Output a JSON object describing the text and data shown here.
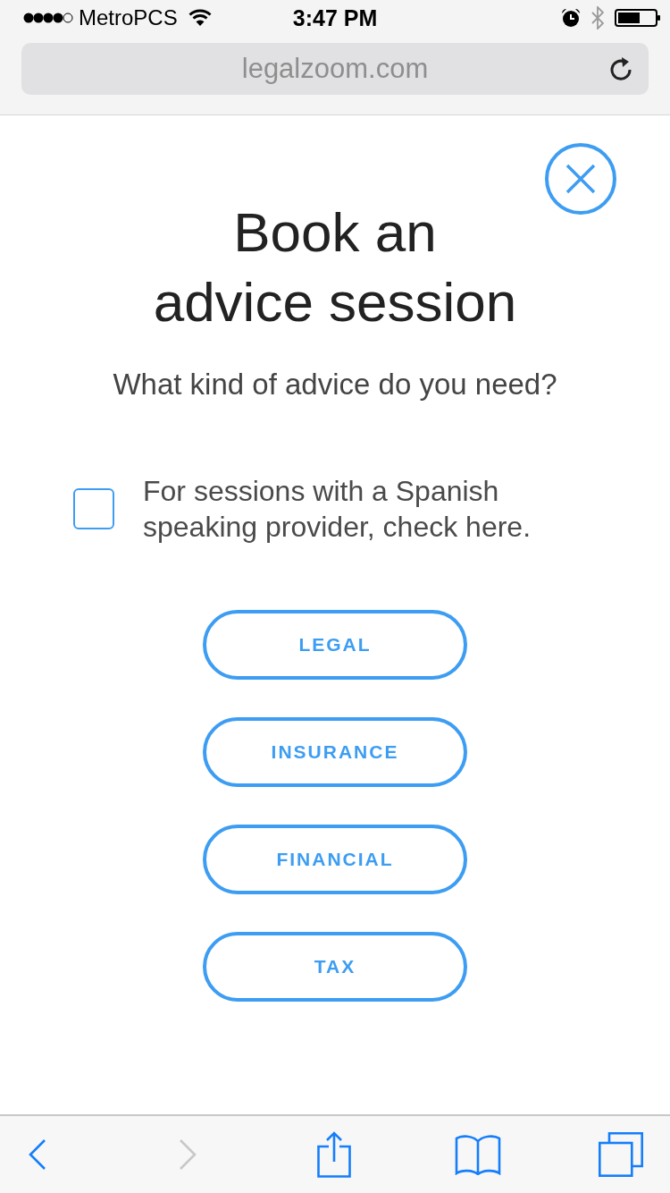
{
  "status_bar": {
    "carrier": "MetroPCS",
    "time": "3:47 PM"
  },
  "address_bar": {
    "url": "legalzoom.com"
  },
  "dialog": {
    "title": "Book an advice session",
    "question": "What kind of advice do you need?",
    "spanish_option": {
      "label": "For sessions with a Spanish speaking provider, check here.",
      "checked": false
    },
    "categories": [
      {
        "label": "LEGAL"
      },
      {
        "label": "INSURANCE"
      },
      {
        "label": "FINANCIAL"
      },
      {
        "label": "TAX"
      }
    ]
  },
  "toolbar": {
    "items": [
      {
        "kind": "back",
        "disabled": false
      },
      {
        "kind": "forward",
        "disabled": true
      },
      {
        "kind": "share",
        "disabled": false
      },
      {
        "kind": "bookmarks",
        "disabled": false
      },
      {
        "kind": "tabs",
        "disabled": false
      }
    ]
  }
}
